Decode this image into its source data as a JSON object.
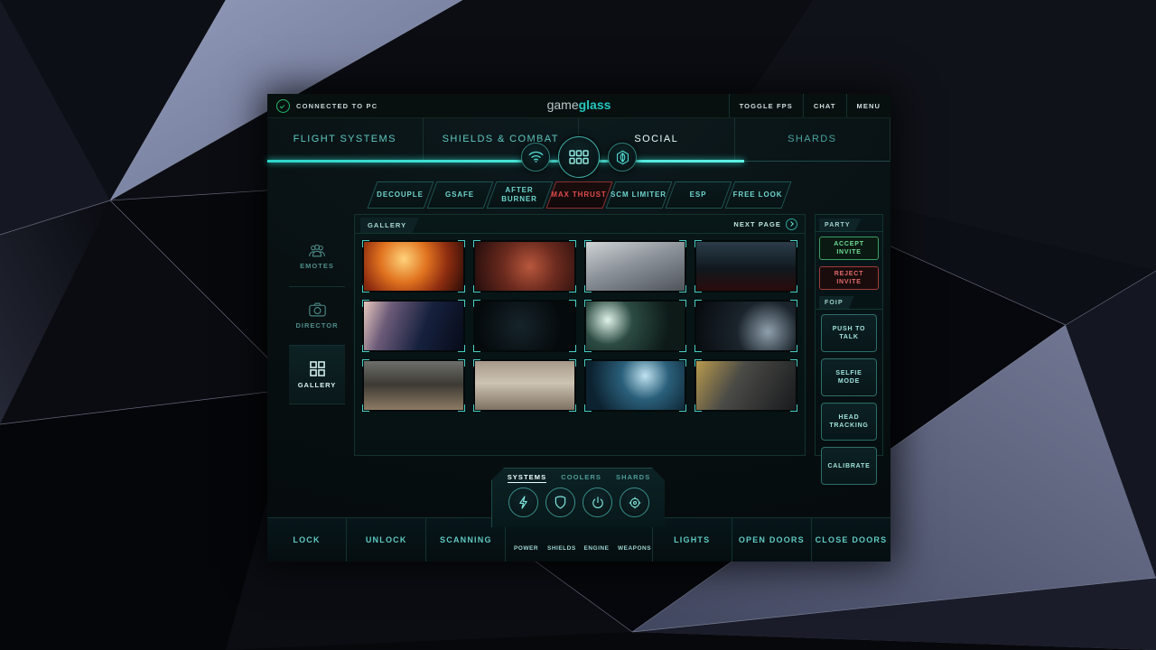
{
  "titlebar": {
    "connection_status": "CONNECTED TO PC",
    "logo_part1": "game",
    "logo_part2": "glass",
    "buttons": [
      {
        "label": "TOGGLE FPS"
      },
      {
        "label": "CHAT"
      },
      {
        "label": "MENU"
      }
    ]
  },
  "main_nav": {
    "items": [
      {
        "label": "FLIGHT SYSTEMS",
        "active": false
      },
      {
        "label": "SHIELDS & COMBAT",
        "active": false
      },
      {
        "label": "SOCIAL",
        "active": true
      },
      {
        "label": "SHARDS",
        "active": false
      }
    ],
    "center_icons": [
      {
        "name": "wifi-icon",
        "size": "small"
      },
      {
        "name": "apps-grid-icon",
        "size": "big"
      },
      {
        "name": "leaf-emblem-icon",
        "size": "small"
      }
    ]
  },
  "sub_nav": {
    "items": [
      {
        "label": "DECOUPLE",
        "active": false
      },
      {
        "label": "GSAFE",
        "active": false
      },
      {
        "label": "AFTER BURNER",
        "active": false
      },
      {
        "label": "MAX THRUST",
        "active": true
      },
      {
        "label": "SCM LIMITER",
        "active": false
      },
      {
        "label": "ESP",
        "active": false
      },
      {
        "label": "FREE LOOK",
        "active": false
      }
    ]
  },
  "rail": {
    "items": [
      {
        "label": "EMOTES",
        "icon": "people-icon",
        "active": false
      },
      {
        "label": "DIRECTOR",
        "icon": "camera-icon",
        "active": false
      },
      {
        "label": "GALLERY",
        "icon": "grid-icon",
        "active": true
      }
    ]
  },
  "gallery": {
    "tab_label": "GALLERY",
    "next_page_label": "NEXT PAGE",
    "thumbnails": [
      {
        "alt": "fighter ship in orange explosion"
      },
      {
        "alt": "red hull ship banking in nebula"
      },
      {
        "alt": "mining vessel over grey asteroid field"
      },
      {
        "alt": "dark hangar interior with red lights"
      },
      {
        "alt": "ship in quantum travel past pink planet"
      },
      {
        "alt": "starmap navigation scanner view"
      },
      {
        "alt": "cockpit of ship with green light"
      },
      {
        "alt": "ringed planet crescent in space"
      },
      {
        "alt": "landed ship on rocky desert"
      },
      {
        "alt": "ground vehicle racing on desert dunes"
      },
      {
        "alt": "sleek ship in blue lit hangar"
      },
      {
        "alt": "armored character in custom shop"
      }
    ]
  },
  "right_panel": {
    "sections": [
      {
        "title": "PARTY",
        "buttons": [
          {
            "label": "ACCEPT INVITE",
            "style": "accept"
          },
          {
            "label": "REJECT INVITE",
            "style": "reject"
          }
        ]
      },
      {
        "title": "FOIP",
        "buttons": [
          {
            "label": "PUSH TO TALK",
            "style": "foip"
          },
          {
            "label": "SELFIE MODE",
            "style": "foip"
          },
          {
            "label": "HEAD TRACKING",
            "style": "foip"
          },
          {
            "label": "CALIBRATE",
            "style": "foip"
          }
        ]
      }
    ]
  },
  "hud": {
    "tabs": [
      {
        "label": "SYSTEMS",
        "active": true
      },
      {
        "label": "COOLERS",
        "active": false
      },
      {
        "label": "SHARDS",
        "active": false
      }
    ],
    "icons": [
      {
        "label": "POWER",
        "icon": "lightning-icon"
      },
      {
        "label": "SHIELDS",
        "icon": "shield-icon"
      },
      {
        "label": "ENGINE",
        "icon": "power-symbol-icon"
      },
      {
        "label": "WEAPONS",
        "icon": "crosshair-icon"
      }
    ]
  },
  "bottom_bar": {
    "left_buttons": [
      {
        "label": "LOCK"
      },
      {
        "label": "UNLOCK"
      },
      {
        "label": "SCANNING"
      }
    ],
    "right_buttons": [
      {
        "label": "LIGHTS"
      },
      {
        "label": "OPEN DOORS"
      },
      {
        "label": "CLOSE DOORS"
      }
    ]
  },
  "colors": {
    "accent_cyan": "#2fd5c9",
    "accent_red": "#e14b4b",
    "accent_green": "#6fdc95",
    "panel_bg": "#081718",
    "text_dim": "#5fc9c2"
  }
}
